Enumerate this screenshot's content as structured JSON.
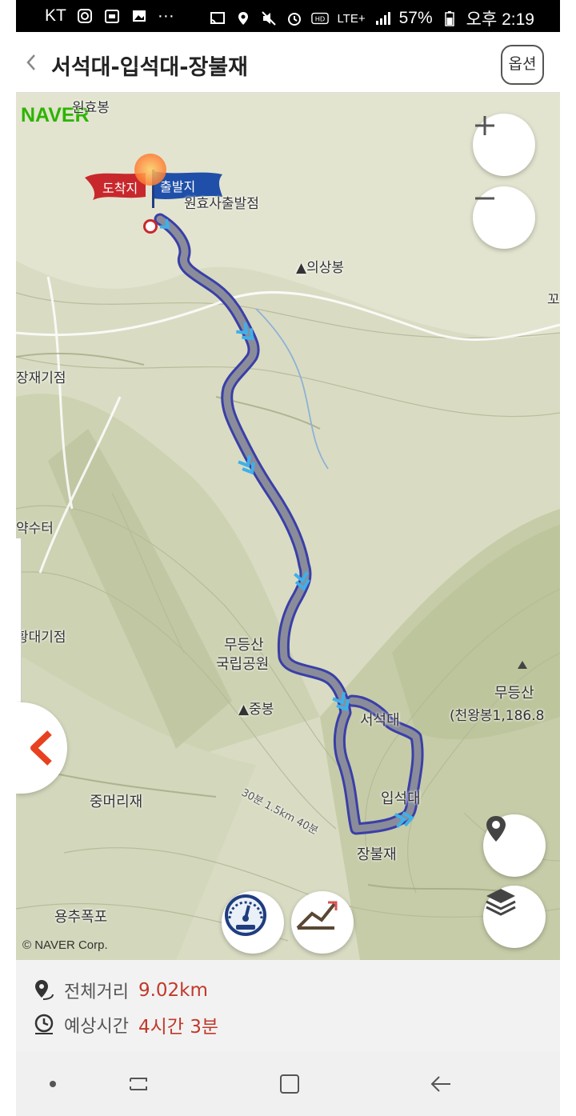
{
  "status_bar": {
    "carrier": "KT",
    "network": "LTE+",
    "battery": "57%",
    "time": "오후 2:19",
    "dots": "···"
  },
  "header": {
    "title": "서석대-입석대-장불재",
    "option_label": "옵션"
  },
  "map": {
    "logo": "NAVER",
    "copyright": "© NAVER Corp.",
    "flags": {
      "arrival": "도착지",
      "departure": "출발지"
    },
    "labels": {
      "wonhyobong": "원효봉",
      "wonhyosa": "원효사출발점",
      "uisangbong": "▲의상봉",
      "jaegijeom": "장재기점",
      "yaksuteo": "약수터",
      "hwangdaegijeom": "황대기점",
      "mudeungsan_park_1": "무등산",
      "mudeungsan_park_2": "국립공원",
      "jungbong": "▲중봉",
      "seoseokdae": "서석대",
      "ipseokdae": "입석대",
      "jangbuljae": "장불재",
      "jungmeorijae": "중머리재",
      "yongchupokpo": "용추폭포",
      "mudeungsan_peak": "무등산",
      "cheonwangbong": "(천왕봉1,186.8",
      "edge_right": "꼬",
      "trail_note": "30분 1.5km 40분"
    },
    "route_color": "#3a3fa8",
    "route_fill": "#8a8c9a",
    "marker_color": "#3fb0e8"
  },
  "summary": {
    "distance_label": "전체거리",
    "distance_value": "9.02km",
    "time_label": "예상시간",
    "time_value": "4시간 3분"
  },
  "icons": {
    "zoom_in": "plus-icon",
    "zoom_out": "minus-icon",
    "location": "map-pin-icon",
    "layers": "layers-icon",
    "speed": "speedometer-icon",
    "elevation": "elevation-profile-icon",
    "collapse": "chevron-left-icon"
  }
}
